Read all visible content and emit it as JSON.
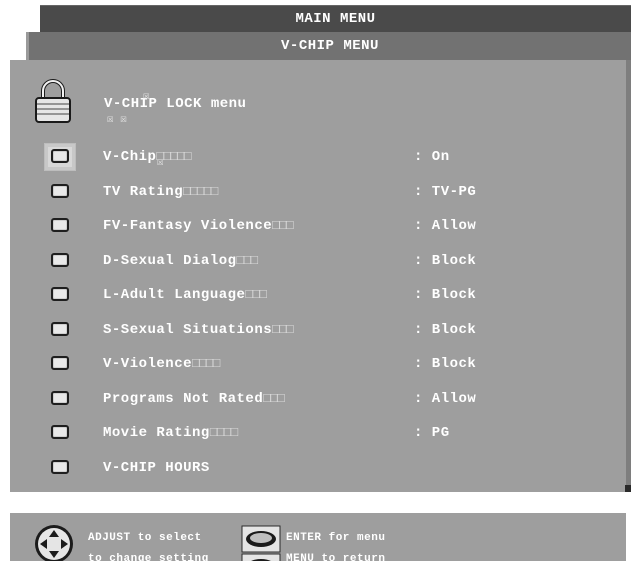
{
  "main_menu": {
    "title": "MAIN MENU"
  },
  "vchip_menu": {
    "title": "V-CHIP MENU"
  },
  "lock_row": {
    "icon": "padlock-icon",
    "title": "V-CHIP LOCK menu",
    "glyph_top": "☒",
    "glyph_bottom": "☒ ☒"
  },
  "items": [
    {
      "icon": "tv-chip-icon",
      "label": "V-Chip",
      "boxes": "□□□□□",
      "value": ": On",
      "selected": true
    },
    {
      "icon": "tv-chip-icon",
      "label": "TV Rating",
      "boxes": "□□□□□",
      "value": ": TV-PG"
    },
    {
      "icon": "tv-chip-icon",
      "label": "FV-Fantasy Violence",
      "boxes": "□□□",
      "value": ": Allow"
    },
    {
      "icon": "tv-chip-icon",
      "label": "D-Sexual Dialog",
      "boxes": "□□□",
      "value": ": Block"
    },
    {
      "icon": "tv-chip-icon",
      "label": "L-Adult Language",
      "boxes": "□□□",
      "value": ": Block"
    },
    {
      "icon": "tv-chip-icon",
      "label": "S-Sexual Situations",
      "boxes": "□□□",
      "value": ": Block"
    },
    {
      "icon": "tv-chip-icon",
      "label": "V-Violence",
      "boxes": "□□□□",
      "value": ": Block"
    },
    {
      "icon": "tv-chip-icon",
      "label": "Programs Not Rated",
      "boxes": "□□□",
      "value": ": Allow"
    },
    {
      "icon": "tv-chip-icon",
      "label": "Movie Rating",
      "boxes": "□□□□",
      "value": ": PG"
    },
    {
      "icon": "tv-chip-icon",
      "label": "V-CHIP HOURS",
      "boxes": "",
      "value": ""
    }
  ],
  "selected_overlay_glyph": "☒",
  "help": {
    "adjust_text": "ADJUST to select",
    "change_text": "to change setting",
    "enter_text": "ENTER for menu",
    "menu_text": "MENU to return",
    "adjust_icon": "dpad-icon",
    "enter_icon": "enter-button-icon",
    "menu_icon": "menu-button-icon"
  },
  "colors": {
    "panel": "#9e9e9e",
    "header": "#727272",
    "main_bar": "#4a4a4a",
    "text": "#ffffff"
  }
}
